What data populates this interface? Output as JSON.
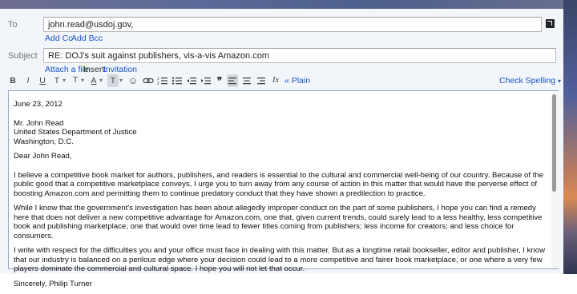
{
  "to": {
    "label": "To",
    "value": "john.read@usdoj.gov,"
  },
  "cc_links": {
    "add_cc": "Add Cc",
    "add_bcc": "Add Bcc"
  },
  "subject": {
    "label": "Subject",
    "value": "RE: DOJ's suit against publishers, vis-a-vis Amazon.com"
  },
  "attach": {
    "attach_file": "Attach a file",
    "insert_label": "Insert:",
    "invitation": "Invitation"
  },
  "toolbar": {
    "bold": "B",
    "italic": "I",
    "underline": "U",
    "font": "T",
    "size": "T",
    "text_color": "A",
    "highlight": "T",
    "plain_text": "« Plain Text",
    "check_spelling": "Check Spelling"
  },
  "message": {
    "date": "June 23, 2012",
    "address": [
      "Mr. John Read",
      "United States Department of Justice",
      "Washington, D.C."
    ],
    "greeting": "Dear John Read,",
    "paragraphs": [
      "I believe a competitive book market for authors, publishers, and readers is essential to the cultural and commercial well-being of our country. Because of the public good that a competitive marketplace conveys, I urge you to turn away from any course of action in this matter that would have the perverse effect of boosting Amazon.com and permitting them to continue predatory conduct that they have shown a predilection to practice.",
      "While I know that the government's investigation has been about allegedly improper conduct on the part of some publishers, I hope you can find a remedy here that does not deliver a new competitive advantage for Amazon.com, one that, given current trends, could surely lead to a less healthy, less competitive book and publishing marketplace, one that would over time lead to fewer titles coming from publishers; less income for creators; and less choice for consumers.",
      "I write with respect for the difficulties you and your office must face in dealing with this matter. But as a longtime retail bookseller, editor and publisher, I know that our industry is balanced on a perilous edge where your decision could lead to a more competitive and fairer book marketplace, or one where a very few players dominate the commercial and cultural space. I hope you will not let that occur."
    ],
    "signoff": "Sincerely,  Philip Turner"
  }
}
